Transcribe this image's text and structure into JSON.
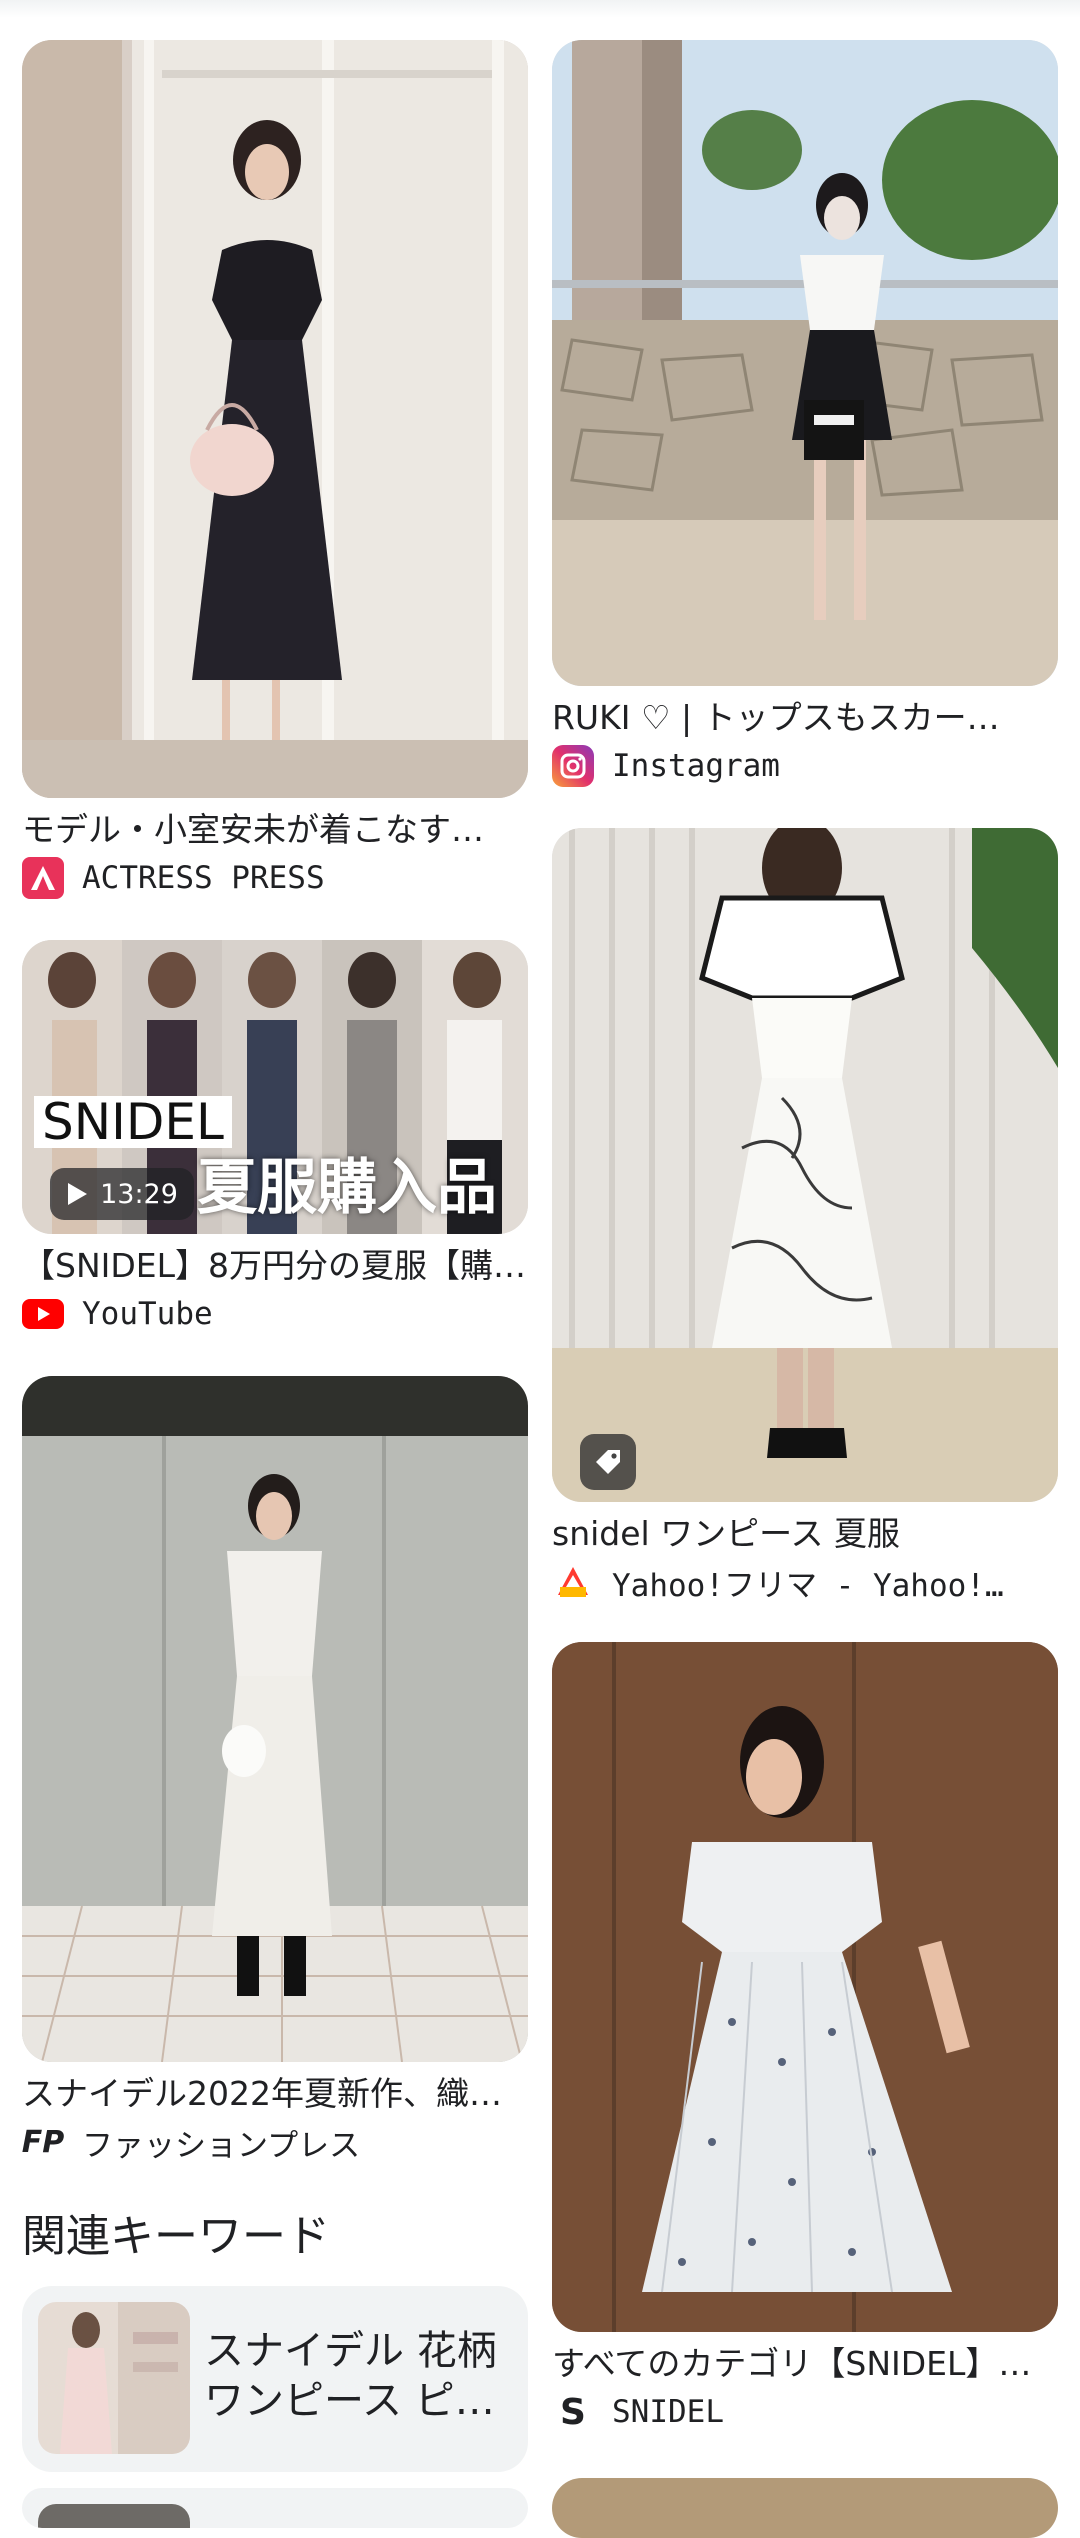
{
  "cards_left": [
    {
      "title": "モデル・小室安未が着こなす…",
      "source": "ACTRESS PRESS",
      "source_icon": "actress-press-logo"
    },
    {
      "title": "【SNIDEL】8万円分の夏服【購…",
      "source": "YouTube",
      "source_icon": "youtube-logo",
      "overlay_brand": "SNIDEL",
      "overlay_caption": "夏服購入品",
      "duration": "13:29"
    },
    {
      "title": "スナイデル2022年夏新作、織…",
      "source": "ファッションプレス",
      "source_icon": "fashion-press-logo",
      "source_icon_text": "FP"
    }
  ],
  "cards_right": [
    {
      "title": "RUKI ♡ | トップスもスカー…",
      "source": "Instagram",
      "source_icon": "instagram-logo"
    },
    {
      "title": "snidel ワンピース 夏服",
      "source": "Yahoo!フリマ - Yahoo!…",
      "source_icon": "yahoo-flea-market-logo",
      "has_shopping_tag": true
    },
    {
      "title": "すべてのカテゴリ【SNIDEL】…",
      "source": "SNIDEL",
      "source_icon": "snidel-logo",
      "source_icon_text": "S"
    }
  ],
  "related": {
    "heading": "関連キーワード",
    "items": [
      {
        "line1": "スナイデル 花柄",
        "line2": "ワンピース ピ…"
      }
    ]
  }
}
